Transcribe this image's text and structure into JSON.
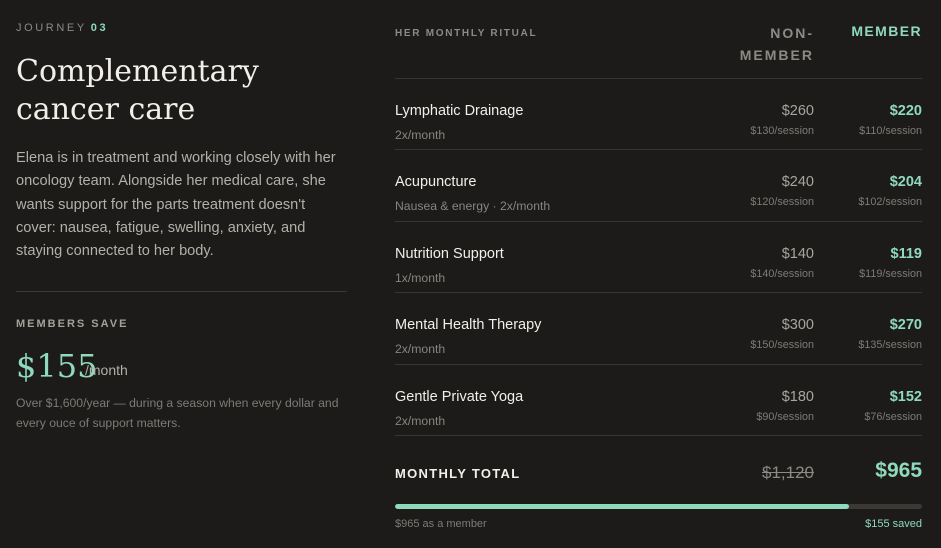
{
  "journey": {
    "label": "JOURNEY",
    "number": "03"
  },
  "title": "Complementary cancer care",
  "description": "Elena is in treatment and working closely with her oncology team. Alongside her medical care, she wants support for the parts treatment doesn't cover: nausea, fatigue, swelling, anxiety, and staying connected to her body.",
  "savings": {
    "label": "MEMBERS SAVE",
    "amount": "$155",
    "unit": "/month",
    "note": "Over $1,600/year — during a season when every dollar and every ouce of support matters."
  },
  "table": {
    "heading": "HER MONTHLY RITUAL",
    "nonmember_head": "NON-MEMBER",
    "member_head": "MEMBER",
    "rows": [
      {
        "name": "Lymphatic Drainage",
        "freq": "2x/month",
        "nm_price": "$260",
        "nm_sess": "$130/session",
        "m_price": "$220",
        "m_sess": "$110/session"
      },
      {
        "name": "Acupuncture",
        "freq": "Nausea & energy · 2x/month",
        "nm_price": "$240",
        "nm_sess": "$120/session",
        "m_price": "$204",
        "m_sess": "$102/session"
      },
      {
        "name": "Nutrition Support",
        "freq": "1x/month",
        "nm_price": "$140",
        "nm_sess": "$140/session",
        "m_price": "$119",
        "m_sess": "$119/session"
      },
      {
        "name": "Mental Health Therapy",
        "freq": "2x/month",
        "nm_price": "$300",
        "nm_sess": "$150/session",
        "m_price": "$270",
        "m_sess": "$135/session"
      },
      {
        "name": "Gentle Private Yoga",
        "freq": "2x/month",
        "nm_price": "$180",
        "nm_sess": "$90/session",
        "m_price": "$152",
        "m_sess": "$76/session"
      }
    ],
    "total_label": "MONTHLY TOTAL",
    "total_nonmember": "$1,120",
    "total_member": "$965"
  },
  "progress": {
    "fraction": 0.862,
    "left_label": "$965 as a member",
    "right_label": "$155 saved"
  },
  "colors": {
    "accent": "#8fd9bd",
    "background": "#1c1b19"
  }
}
